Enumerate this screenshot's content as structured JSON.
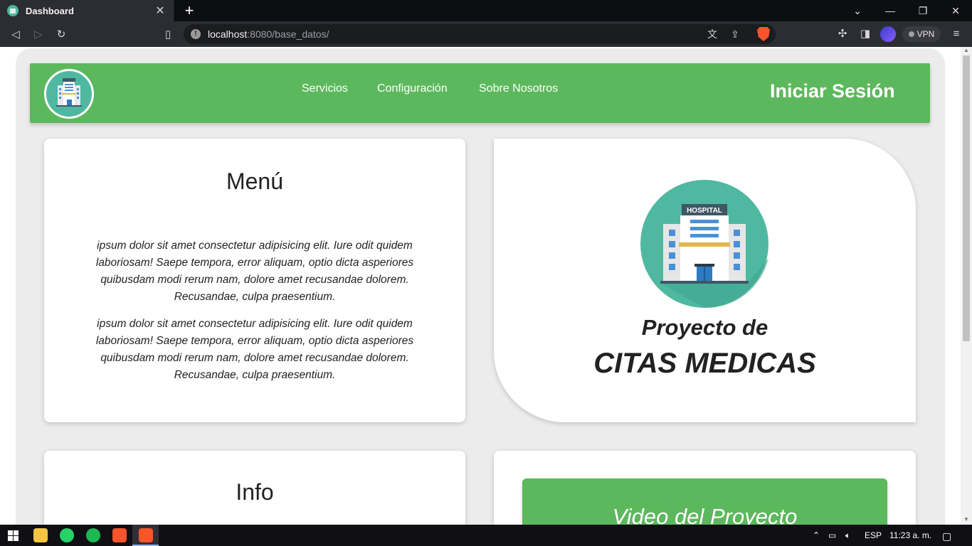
{
  "browser": {
    "tab_title": "Dashboard",
    "tab_close": "✕",
    "new_tab": "+",
    "url_host": "localhost",
    "url_rest": ":8080/base_datos/",
    "vpn_label": "VPN"
  },
  "site": {
    "nav": [
      "Servicios",
      "Configuración",
      "Sobre Nosotros"
    ],
    "login": "Iniciar Sesión",
    "hospital_sign": "HOSPITAL"
  },
  "menu_card": {
    "title": "Menú",
    "paragraphs": [
      "ipsum dolor sit amet consectetur adipisicing elit. Iure odit quidem laboriosam! Saepe tempora, error aliquam, optio dicta asperiores quibusdam modi rerum nam, dolore amet recusandae dolorem. Recusandae, culpa praesentium.",
      "ipsum dolor sit amet consectetur adipisicing elit. Iure odit quidem laboriosam! Saepe tempora, error aliquam, optio dicta asperiores quibusdam modi rerum nam, dolore amet recusandae dolorem. Recusandae, culpa praesentium."
    ]
  },
  "hero": {
    "line1": "Proyecto de",
    "line2": "CITAS MEDICAS"
  },
  "info_card": {
    "title": "Info"
  },
  "video_card": {
    "title": "Video del Proyecto"
  },
  "taskbar": {
    "lang": "ESP",
    "clock": "11:23 a. m."
  },
  "colors": {
    "brand_green": "#5cb85c",
    "hospital_teal": "#4fb8a0"
  }
}
